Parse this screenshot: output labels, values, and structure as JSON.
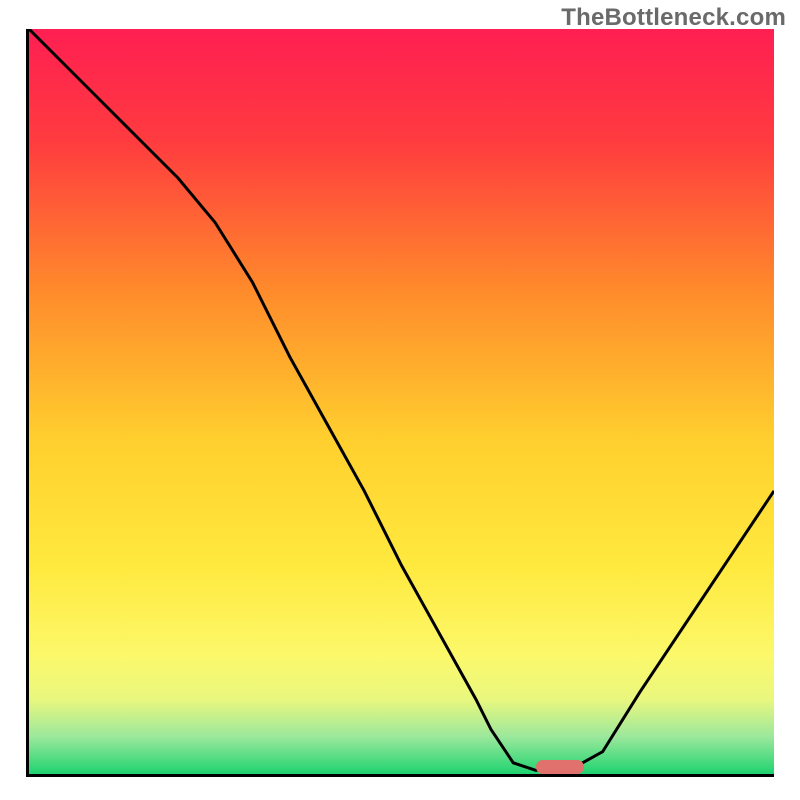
{
  "watermark": "TheBottleneck.com",
  "chart_data": {
    "type": "line",
    "title": "",
    "xlabel": "",
    "ylabel": "",
    "xlim": [
      0,
      100
    ],
    "ylim": [
      0,
      100
    ],
    "x": [
      0,
      5,
      10,
      15,
      20,
      25,
      30,
      35,
      40,
      45,
      50,
      55,
      60,
      62,
      65,
      68,
      71,
      72.5,
      77,
      82,
      88,
      94,
      100
    ],
    "values": [
      100,
      95,
      90,
      85,
      80,
      74,
      66,
      56,
      47,
      38,
      28,
      19,
      10,
      6,
      1.5,
      0.5,
      0.5,
      0.5,
      3,
      11,
      20,
      29,
      38
    ],
    "optimal_range_x": [
      68,
      74.5
    ],
    "gradient_stops": [
      {
        "offset": 0.0,
        "color": "#ff1f52"
      },
      {
        "offset": 0.15,
        "color": "#ff3b3f"
      },
      {
        "offset": 0.35,
        "color": "#ff8a2b"
      },
      {
        "offset": 0.55,
        "color": "#ffcf2e"
      },
      {
        "offset": 0.72,
        "color": "#ffe93e"
      },
      {
        "offset": 0.84,
        "color": "#fcf86a"
      },
      {
        "offset": 0.9,
        "color": "#e9f77e"
      },
      {
        "offset": 0.95,
        "color": "#9be89c"
      },
      {
        "offset": 1.0,
        "color": "#1fd370"
      }
    ],
    "marker_color": "#e1716c",
    "line_color": "#000000",
    "line_width": 3
  }
}
